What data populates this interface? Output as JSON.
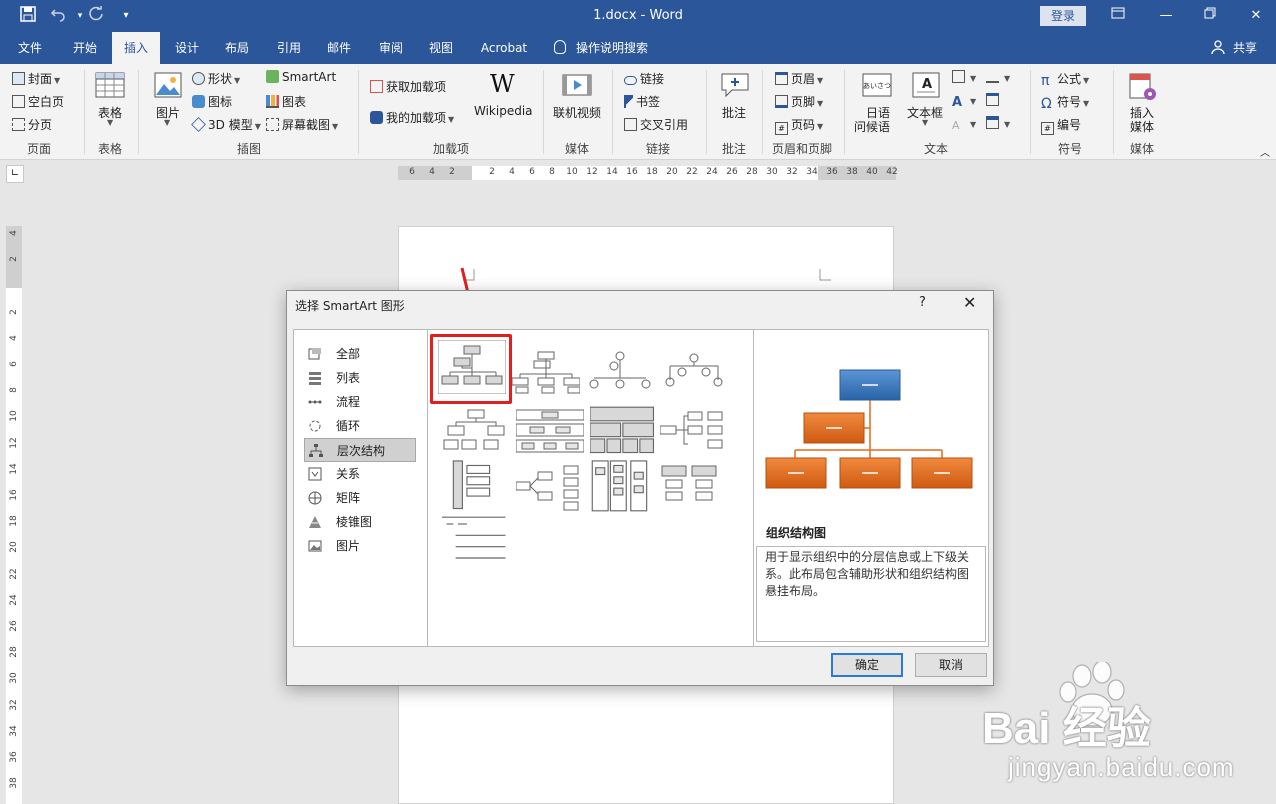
{
  "titlebar": {
    "title": "1.docx  -  Word",
    "login": "登录",
    "save_icon": "save-icon",
    "undo_icon": "undo-icon",
    "redo_icon": "redo-icon"
  },
  "menu": {
    "tabs": [
      "文件",
      "开始",
      "插入",
      "设计",
      "布局",
      "引用",
      "邮件",
      "审阅",
      "视图",
      "Acrobat"
    ],
    "active": "插入",
    "search": "操作说明搜索",
    "share": "共享"
  },
  "ribbon": {
    "page": {
      "cover": "封面",
      "blank": "空白页",
      "break": "分页",
      "label": "页面"
    },
    "table": {
      "button": "表格",
      "label": "表格"
    },
    "illustrations": {
      "picture": "图片",
      "shapes": "形状",
      "icons": "图标",
      "model3d": "3D 模型",
      "smartart": "SmartArt",
      "chart": "图表",
      "screenshot": "屏幕截图",
      "label": "插图"
    },
    "addins": {
      "get": "获取加载项",
      "mine": "我的加载项",
      "wikipedia": "Wikipedia",
      "label": "加载项"
    },
    "media": {
      "video": "联机视频",
      "label": "媒体"
    },
    "links": {
      "link": "链接",
      "bookmark": "书签",
      "crossref": "交叉引用",
      "label": "链接"
    },
    "comments": {
      "comment": "批注",
      "label": "批注"
    },
    "header_footer": {
      "header": "页眉",
      "footer": "页脚",
      "page_number": "页码",
      "label": "页眉和页脚"
    },
    "text": {
      "greeting_line1": "日语",
      "greeting_line2": "问候语",
      "textbox": "文本框",
      "label": "文本"
    },
    "symbols": {
      "equation": "公式",
      "symbol": "符号",
      "number": "编号",
      "label": "符号"
    },
    "insert_media": {
      "line1": "插入",
      "line2": "媒体",
      "label": "媒体"
    }
  },
  "ruler": {
    "h_ticks": [
      "6",
      "4",
      "2",
      "",
      "2",
      "4",
      "6",
      "8",
      "10",
      "12",
      "14",
      "16",
      "18",
      "20",
      "22",
      "24",
      "26",
      "28",
      "30",
      "32",
      "34",
      "36",
      "38",
      "40",
      "42"
    ],
    "v_ticks": [
      "4",
      "2",
      "",
      "2",
      "4",
      "6",
      "8",
      "10",
      "12",
      "14",
      "16",
      "18",
      "20",
      "22",
      "24",
      "26",
      "28",
      "30",
      "32",
      "34",
      "36",
      "38"
    ]
  },
  "dialog": {
    "title": "选择 SmartArt 图形",
    "help": "?",
    "close": "✕",
    "categories": [
      "全部",
      "列表",
      "流程",
      "循环",
      "层次结构",
      "关系",
      "矩阵",
      "棱锥图",
      "图片"
    ],
    "selected_category": "层次结构",
    "preview_title": "组织结构图",
    "preview_desc": "用于显示组织中的分层信息或上下级关系。此布局包含辅助形状和组织结构图悬挂布局。",
    "ok": "确定",
    "cancel": "取消",
    "preview_colors": {
      "top": "#3a78c2",
      "children": "#e36c1f"
    }
  },
  "watermark": {
    "main": "Bai 经验",
    "sub": "jingyan.baidu.com"
  }
}
